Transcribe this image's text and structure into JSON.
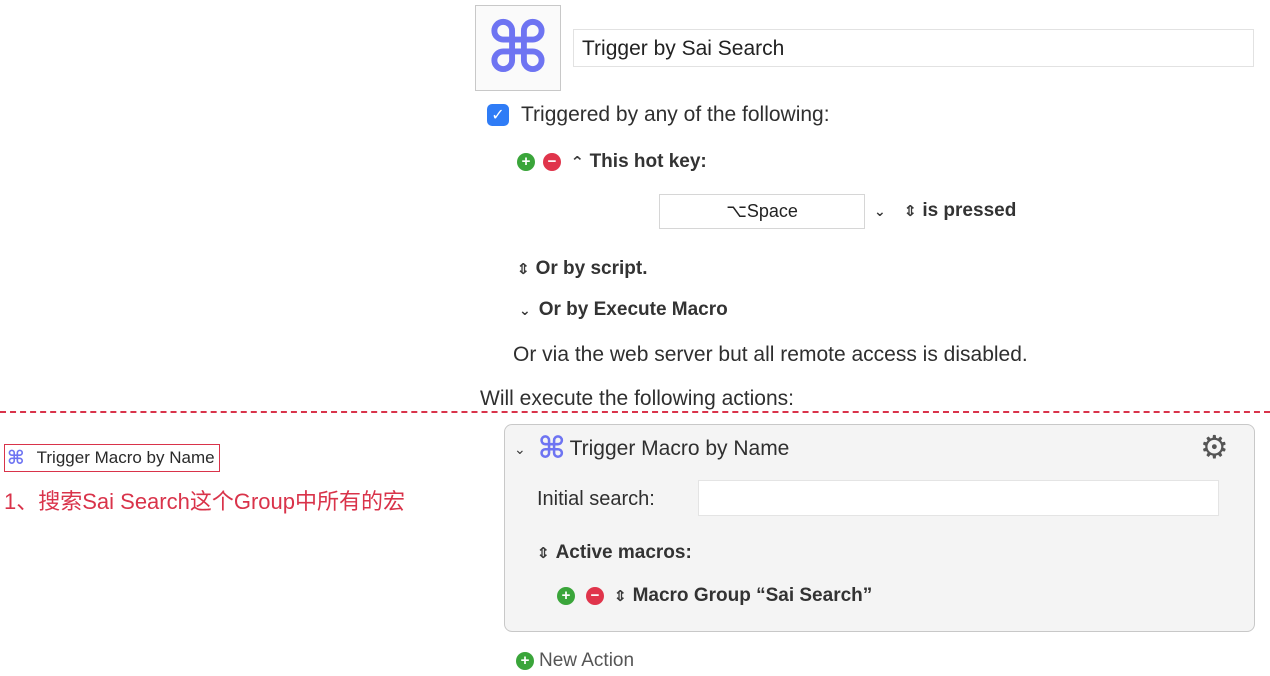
{
  "macro": {
    "icon": "command-icon",
    "name": "Trigger by Sai Search"
  },
  "triggers": {
    "checkbox_label": "Triggered by any of the following:",
    "hotkey_label": "This hot key:",
    "hotkey_value": "⌥Space",
    "hotkey_condition": "is pressed",
    "or_script": "Or by script.",
    "or_execute": "Or by Execute Macro",
    "web_server": "Or via the web server but all remote access is disabled."
  },
  "actions_heading": "Will execute the following actions:",
  "annotation": {
    "label": "Trigger Macro by Name",
    "note": "1、搜索Sai Search这个Group中所有的宏",
    "color": "#d9334a"
  },
  "action": {
    "title": "Trigger Macro by Name",
    "search_label": "Initial search:",
    "search_value": "",
    "active_label": "Active macros:",
    "group_item": "Macro Group “Sai Search”"
  },
  "new_action": "New Action",
  "glyphs": {
    "command": "⌘",
    "check": "✓",
    "plus": "+",
    "minus": "−",
    "updown": "⌃⌄",
    "chevron": "⌄",
    "gear": "⚙"
  },
  "colors": {
    "accent_blue": "#2f7cf6",
    "icon_purple": "#6e74f2",
    "add_green": "#3aa53a",
    "remove_red": "#e0344b"
  }
}
